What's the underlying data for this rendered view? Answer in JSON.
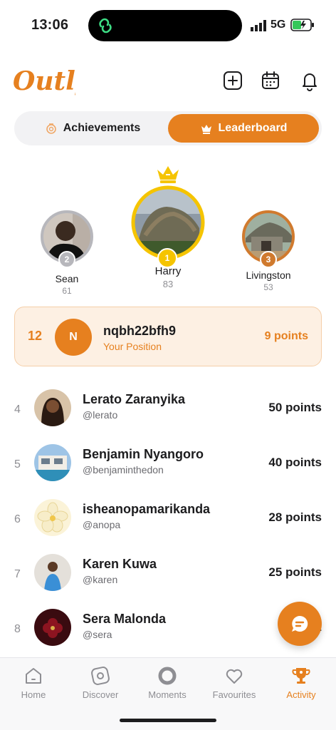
{
  "status": {
    "time": "13:06",
    "network": "5G"
  },
  "header": {
    "logo": "Outly"
  },
  "tabs": [
    {
      "label": "Achievements",
      "active": false,
      "icon": "medal-icon"
    },
    {
      "label": "Leaderboard",
      "active": true,
      "icon": "crown-icon"
    }
  ],
  "podium": [
    {
      "rank": "2",
      "name": "Sean",
      "points": "61"
    },
    {
      "rank": "1",
      "name": "Harry",
      "points": "83"
    },
    {
      "rank": "3",
      "name": "Livingston",
      "points": "53"
    }
  ],
  "my_position": {
    "rank": "12",
    "initial": "N",
    "name": "nqbh22bfh9",
    "subtitle": "Your Position",
    "points": "9 points"
  },
  "leaderboard": [
    {
      "rank": "4",
      "name": "Lerato Zaranyika",
      "handle": "@lerato",
      "points": "50 points"
    },
    {
      "rank": "5",
      "name": "Benjamin Nyangoro",
      "handle": "@benjaminthedon",
      "points": "40 points"
    },
    {
      "rank": "6",
      "name": "isheanopamarikanda",
      "handle": "@anopa",
      "points": "28 points"
    },
    {
      "rank": "7",
      "name": "Karen Kuwa",
      "handle": "@karen",
      "points": "25 points"
    },
    {
      "rank": "8",
      "name": "Sera Malonda",
      "handle": "@sera",
      "points": "2"
    }
  ],
  "nav": [
    {
      "label": "Home",
      "icon": "home-icon",
      "active": false
    },
    {
      "label": "Discover",
      "icon": "compass-icon",
      "active": false
    },
    {
      "label": "Moments",
      "icon": "circle-icon",
      "active": false
    },
    {
      "label": "Favourites",
      "icon": "heart-icon",
      "active": false
    },
    {
      "label": "Activity",
      "icon": "trophy-icon",
      "active": true
    }
  ],
  "colors": {
    "accent": "#e6801f",
    "gold": "#f5c400",
    "silver": "#b7b7bc",
    "bronze": "#d07a2e"
  }
}
